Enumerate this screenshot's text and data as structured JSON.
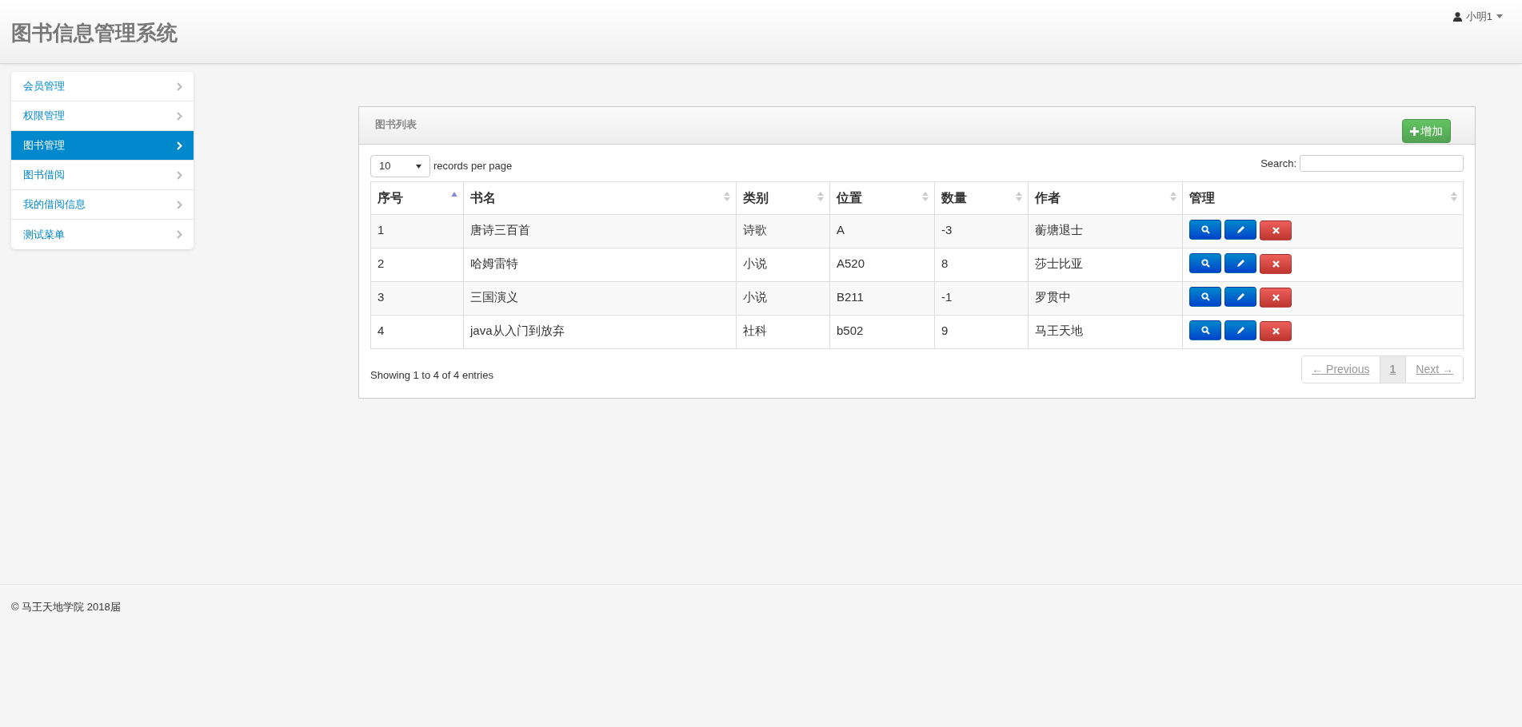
{
  "header": {
    "title": "图书信息管理系统",
    "user": "小明1"
  },
  "sidebar": {
    "items": [
      {
        "label": "会员管理",
        "selected": false
      },
      {
        "label": "权限管理",
        "selected": false
      },
      {
        "label": "图书管理",
        "selected": true
      },
      {
        "label": "图书借阅",
        "selected": false
      },
      {
        "label": "我的借阅信息",
        "selected": false
      },
      {
        "label": "测试菜单",
        "selected": false
      }
    ]
  },
  "panel": {
    "title": "图书列表",
    "add_button": "增加",
    "page_size": {
      "value": "10",
      "label": "records per page"
    },
    "search": {
      "label": "Search:"
    },
    "table": {
      "columns": [
        {
          "label": "序号",
          "sorted": true
        },
        {
          "label": "书名",
          "sorted": false
        },
        {
          "label": "类别",
          "sorted": false
        },
        {
          "label": "位置",
          "sorted": false
        },
        {
          "label": "数量",
          "sorted": false
        },
        {
          "label": "作者",
          "sorted": false
        },
        {
          "label": "管理",
          "sorted": false
        }
      ],
      "rows": [
        [
          "1",
          "唐诗三百首",
          "诗歌",
          "A",
          "-3",
          "蘅塘退士"
        ],
        [
          "2",
          "哈姆雷特",
          "小说",
          "A520",
          "8",
          "莎士比亚"
        ],
        [
          "3",
          "三国演义",
          "小说",
          "B211",
          "-1",
          "罗贯中"
        ],
        [
          "4",
          "java从入门到放弃",
          "社科",
          "b502",
          "9",
          "马王天地"
        ]
      ]
    },
    "info": "Showing 1 to 4 of 4 entries",
    "pagination": [
      {
        "label": "← Previous",
        "selected": false,
        "disabled": true
      },
      {
        "label": "1",
        "selected": true,
        "disabled": false
      },
      {
        "label": "Next →",
        "selected": false,
        "disabled": true
      }
    ]
  },
  "footer": "© 马王天地学院 2018届"
}
